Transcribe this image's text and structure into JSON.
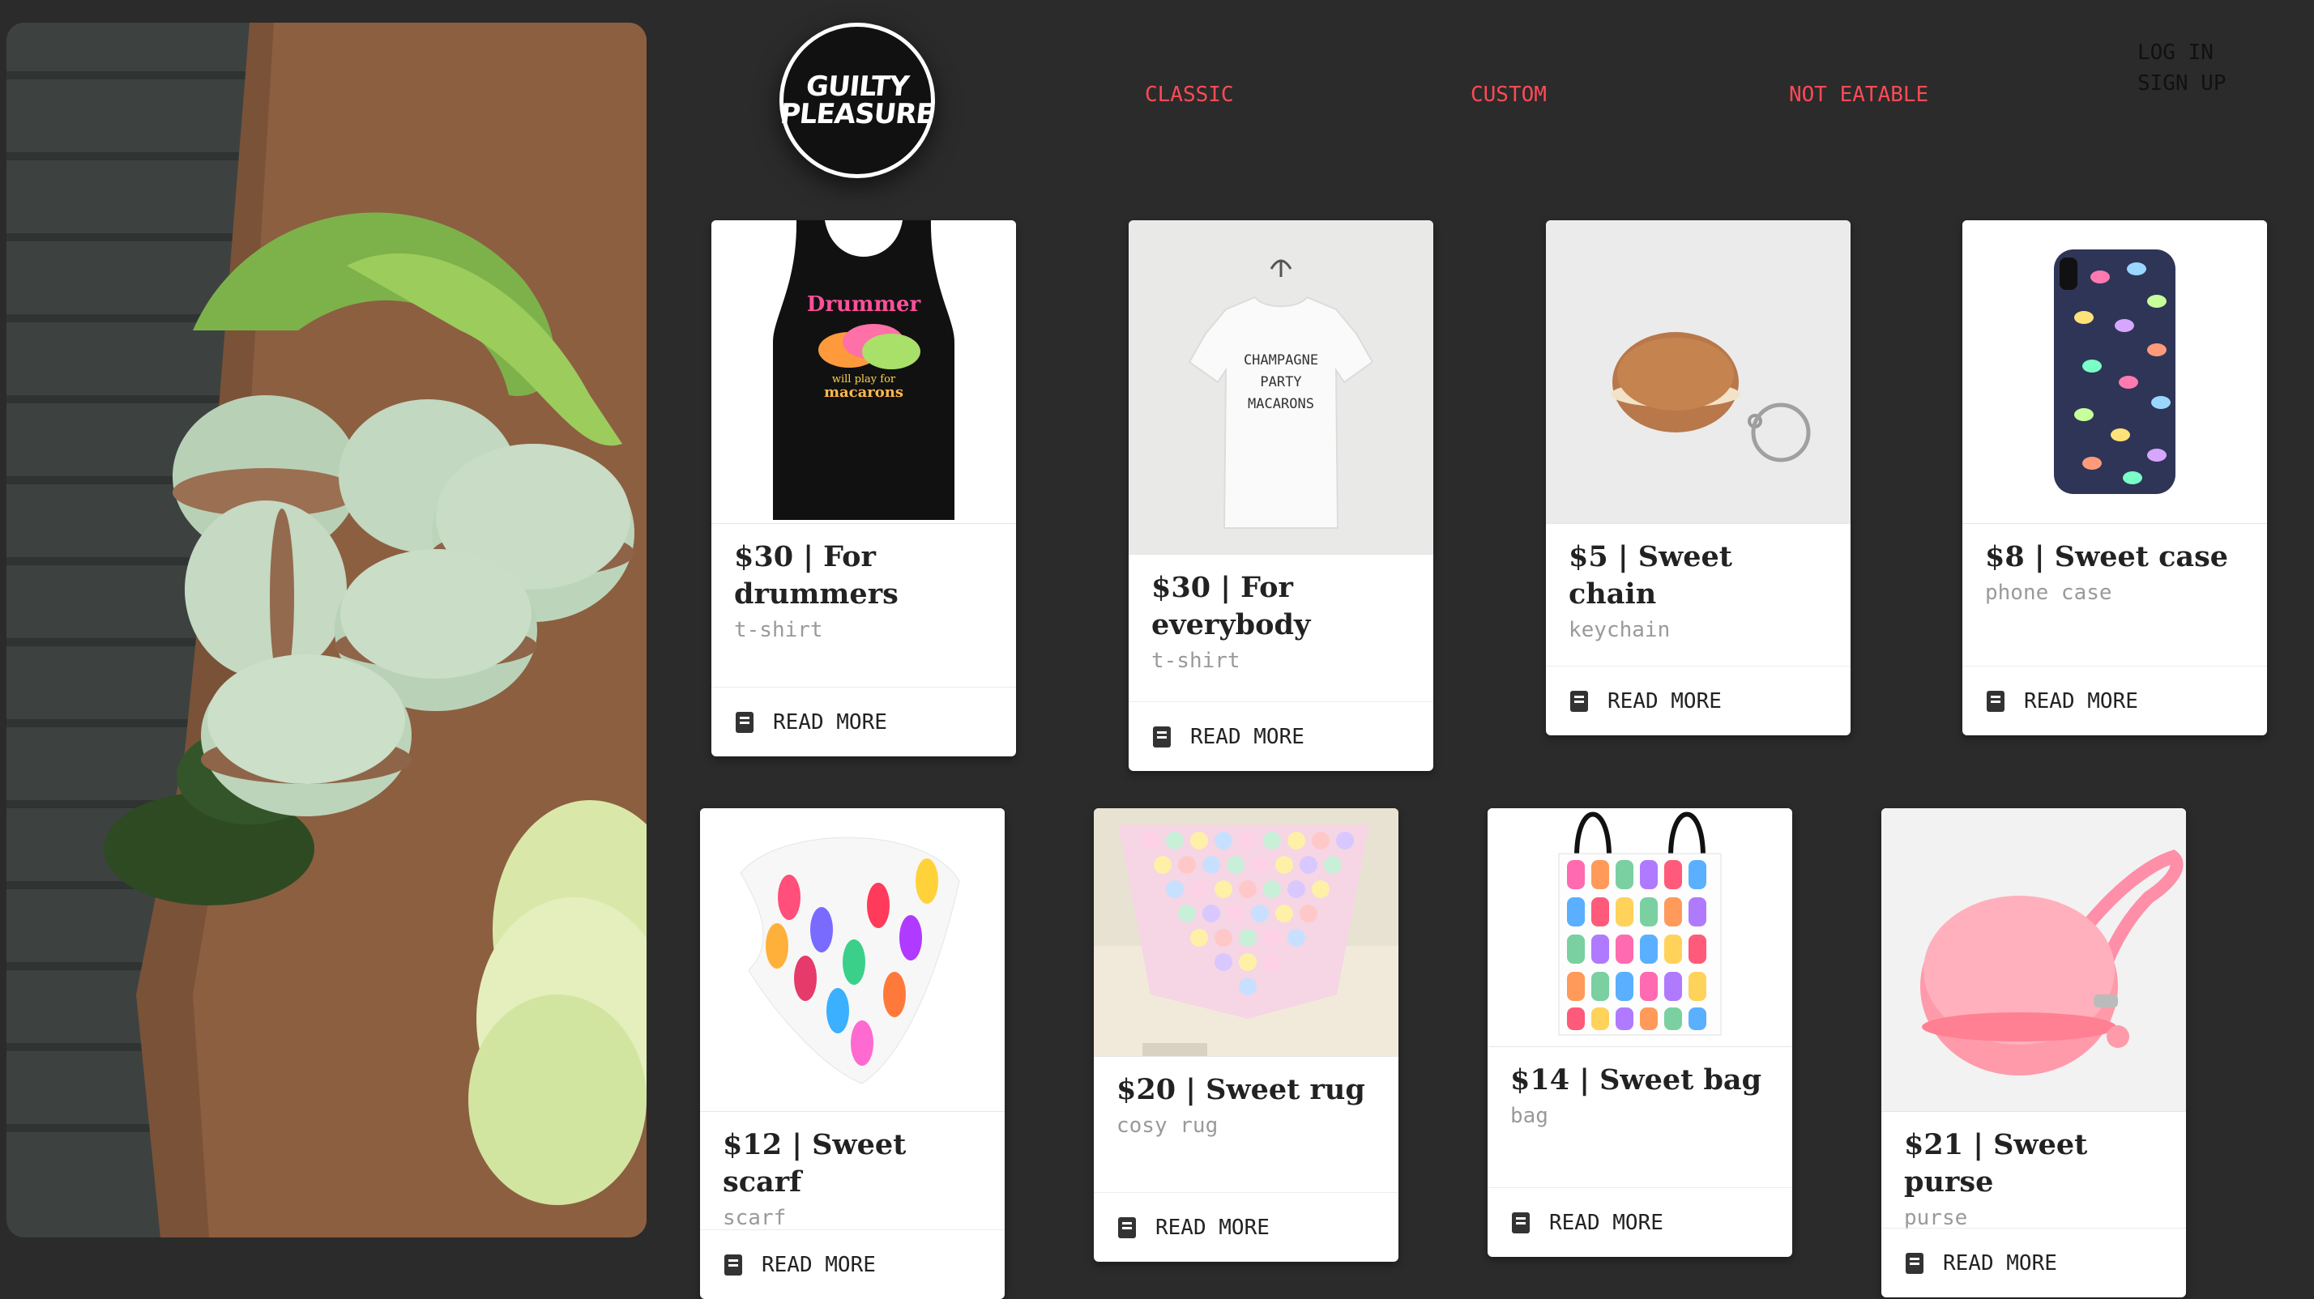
{
  "brand": {
    "logo_line1": "GUILTY",
    "logo_line2": "PLEASURE"
  },
  "nav": {
    "classic": "CLASSIC",
    "custom": "CUSTOM",
    "not_eatable": "NOT EATABLE"
  },
  "auth": {
    "login": "LOG IN",
    "signup": "SIGN UP"
  },
  "colors": {
    "background": "#2b2b2b",
    "nav_accent": "#ff4a55",
    "card": "#ffffff"
  },
  "action_label": "READ MORE",
  "products": [
    {
      "title": "$30 | For drummers",
      "category": "t-shirt",
      "icon": "tank-top-image"
    },
    {
      "title": "$30 | For everybody",
      "category": "t-shirt",
      "icon": "tshirt-image"
    },
    {
      "title": "$5 | Sweet chain",
      "category": "keychain",
      "icon": "keychain-image"
    },
    {
      "title": "$8 | Sweet case",
      "category": "phone case",
      "icon": "phone-case-image"
    },
    {
      "title": "$12 | Sweet scarf",
      "category": "scarf",
      "icon": "scarf-image"
    },
    {
      "title": "$20 | Sweet rug",
      "category": "cosy rug",
      "icon": "rug-image"
    },
    {
      "title": "$14 | Sweet bag",
      "category": "bag",
      "icon": "bag-image"
    },
    {
      "title": "$21 | Sweet purse",
      "category": "purse",
      "icon": "purse-image"
    }
  ],
  "image_text": {
    "tank_line1": "Drummer",
    "tank_line2": "will play for",
    "tank_line3": "macarons",
    "tee_line1": "CHAMPAGNE",
    "tee_line2": "PARTY",
    "tee_line3": "MACARONS"
  }
}
